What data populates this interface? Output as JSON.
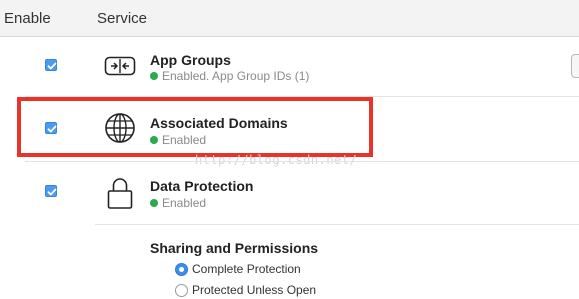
{
  "header": {
    "enable_label": "Enable",
    "service_label": "Service"
  },
  "services": [
    {
      "name": "App Groups",
      "status": "Enabled. App Group IDs (1)",
      "enabled": true,
      "icon": "app-groups-icon"
    },
    {
      "name": "Associated Domains",
      "status": "Enabled",
      "enabled": true,
      "icon": "globe-icon",
      "highlighted": true
    },
    {
      "name": "Data Protection",
      "status": "Enabled",
      "enabled": true,
      "icon": "lock-icon"
    }
  ],
  "sharing": {
    "title": "Sharing and Permissions",
    "options": [
      {
        "label": "Complete Protection",
        "selected": true
      },
      {
        "label": "Protected Unless Open",
        "selected": false
      }
    ]
  },
  "watermark": "http://blog.csdn.net/",
  "colors": {
    "highlight": "#e8332c",
    "status_green": "#2ca94b",
    "checkbox_blue": "#4b9cf0"
  }
}
